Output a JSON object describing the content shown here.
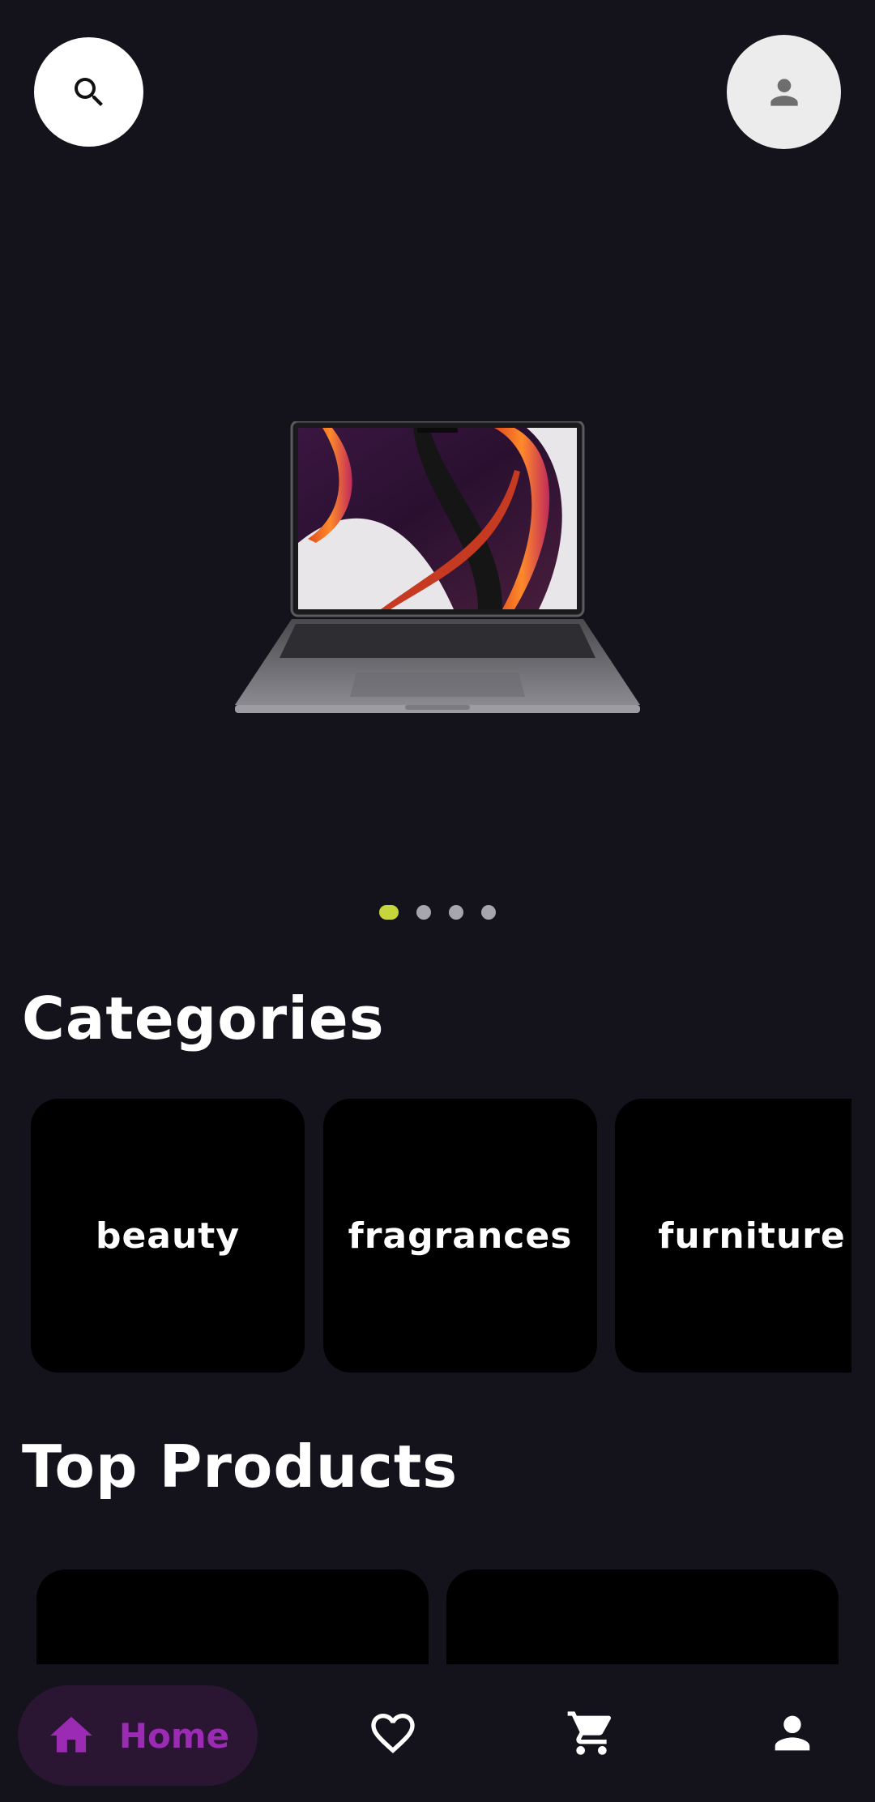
{
  "header": {
    "search_button_icon": "search-icon",
    "profile_button_icon": "person-icon"
  },
  "carousel": {
    "image": "laptop",
    "slide_count": 4,
    "active_slide": 1
  },
  "categories": {
    "title": "Categories",
    "items": [
      {
        "label": "beauty"
      },
      {
        "label": "fragrances"
      },
      {
        "label": "furniture"
      }
    ]
  },
  "top_products": {
    "title": "Top Products"
  },
  "bottom_nav": {
    "items": [
      {
        "label": "Home",
        "icon": "home-icon",
        "active": true
      },
      {
        "label": "",
        "icon": "heart-icon",
        "active": false
      },
      {
        "label": "",
        "icon": "cart-icon",
        "active": false
      },
      {
        "label": "",
        "icon": "person-icon",
        "active": false
      }
    ]
  },
  "colors": {
    "background": "#14121a",
    "card": "#000000",
    "dot_active": "#c6d63a",
    "dot_inactive": "#a8a6ad",
    "nav_active_bg": "#2a1533",
    "nav_active_fg": "#9b2bb3"
  }
}
